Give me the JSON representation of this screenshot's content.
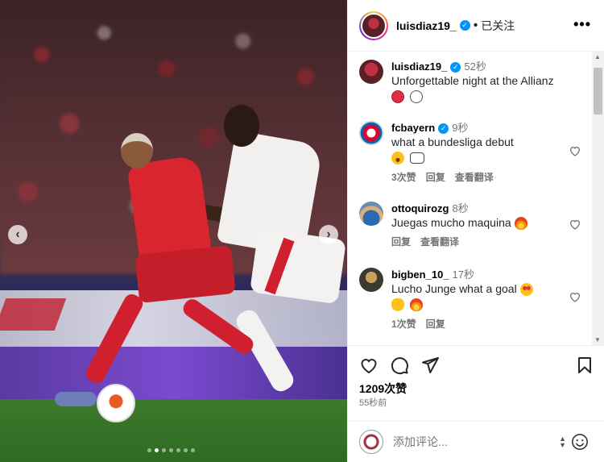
{
  "post": {
    "author": "luisdiaz19_",
    "follow_label": "已关注",
    "separator": "•",
    "more_label": "•••",
    "carousel": {
      "dot_count": 7,
      "active_dot": 1,
      "prev_arrow": "‹",
      "next_arrow": "›"
    }
  },
  "comments": [
    {
      "user": "luisdiaz19_",
      "verified": true,
      "time": "52秒",
      "text": "Unforgettable night at the Allianz",
      "emojis": [
        "red-circle",
        "white-circle"
      ],
      "meta": []
    },
    {
      "user": "fcbayern",
      "verified": true,
      "time": "9秒",
      "text": "what a bundesliga debut",
      "emojis": [
        "astonished-face",
        "pointing-hand"
      ],
      "meta": [
        "3次赞",
        "回复",
        "查看翻译"
      ]
    },
    {
      "user": "ottoquirozg",
      "verified": false,
      "time": "8秒",
      "text": "Juegas mucho maquina",
      "emojis": [
        "fire"
      ],
      "meta": [
        "回复",
        "查看翻译"
      ]
    },
    {
      "user": "bigben_10_",
      "verified": false,
      "time": "17秒",
      "text": "Lucho Junge what a goal",
      "emojis": [
        "star-struck",
        "clapping-hands",
        "fire"
      ],
      "meta": [
        "1次赞",
        "回复"
      ]
    }
  ],
  "stats": {
    "likes": "1209次赞",
    "posted": "55秒前"
  },
  "composer": {
    "placeholder": "添加评论..."
  },
  "colors": {
    "verified": "#0095f6",
    "muted": "#737373",
    "red": "#d9252f"
  },
  "icons": [
    "heart-icon",
    "comment-icon",
    "share-icon",
    "bookmark-icon",
    "smile-icon"
  ]
}
